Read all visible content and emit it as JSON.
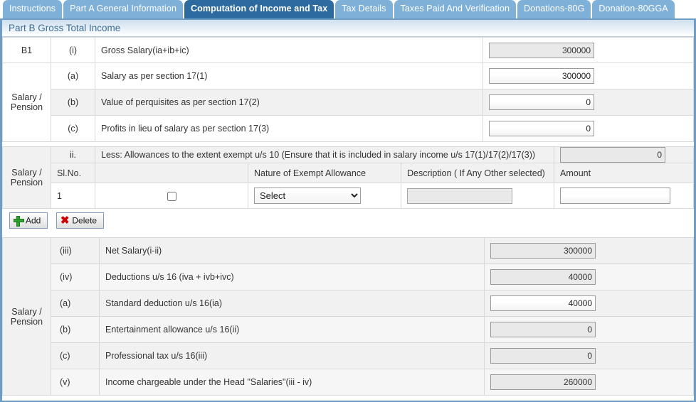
{
  "tabs": [
    {
      "label": "Instructions",
      "active": false
    },
    {
      "label": "Part A General Information",
      "active": false
    },
    {
      "label": "Computation of Income and Tax",
      "active": true
    },
    {
      "label": "Tax Details",
      "active": false
    },
    {
      "label": "Taxes Paid And Verification",
      "active": false
    },
    {
      "label": "Donations-80G",
      "active": false
    },
    {
      "label": "Donation-80GGA",
      "active": false
    }
  ],
  "section": {
    "title": "Part B Gross Total Income"
  },
  "rows": {
    "b1": {
      "code": "B1",
      "roman": "(i)",
      "label": "Gross Salary(ia+ib+ic)",
      "value": "300000",
      "readonly": true
    },
    "group1_label": "Salary /\nPension",
    "a": {
      "roman": "(a)",
      "label": "Salary as per section 17(1)",
      "value": "300000",
      "readonly": false
    },
    "b": {
      "roman": "(b)",
      "label": "Value of perquisites as per section 17(2)",
      "value": "0",
      "readonly": false
    },
    "c": {
      "roman": "(c)",
      "label": "Profits in lieu of salary as per section 17(3)",
      "value": "0",
      "readonly": false
    },
    "ii": {
      "roman": "ii.",
      "label": "Less: Allowances to the extent exempt u/s 10 (Ensure that it is included in salary income u/s 17(1)/17(2)/17(3))",
      "value": "0",
      "readonly": true
    },
    "group2_label": "Salary /\nPension",
    "iii": {
      "roman": "(iii)",
      "label": "Net Salary(i-ii)",
      "value": "300000",
      "readonly": true
    },
    "iv": {
      "roman": "(iv)",
      "label": "Deductions u/s 16 (iva + ivb+ivc)",
      "value": "40000",
      "readonly": true
    },
    "d_a": {
      "roman": "(a)",
      "label": "Standard deduction u/s 16(ia)",
      "value": "40000",
      "readonly": false
    },
    "d_b": {
      "roman": "(b)",
      "label": "Entertainment allowance u/s 16(ii)",
      "value": "0",
      "readonly": true
    },
    "d_c": {
      "roman": "(c)",
      "label": "Professional tax u/s 16(iii)",
      "value": "0",
      "readonly": true
    },
    "v": {
      "roman": "(v)",
      "label": "Income chargeable under the Head \"Salaries\"(iii - iv)",
      "value": "260000",
      "readonly": true
    },
    "group3_label": "Salary /\nPension"
  },
  "allowance_table": {
    "headers": {
      "sl": "Sl.No.",
      "check": "",
      "nature": "Nature of Exempt Allowance",
      "description": "Description ( If Any Other selected)",
      "amount": "Amount"
    },
    "rows": [
      {
        "sl": "1",
        "checked": false,
        "nature_selected": "Select",
        "nature_options": [
          "Select"
        ],
        "description": "",
        "amount": ""
      }
    ],
    "buttons": {
      "add": "Add",
      "delete": "Delete"
    }
  },
  "colors": {
    "tab_active": "#2d6a9f",
    "tab_inactive": "#7fb0d8",
    "frame_border": "#6e9cc4",
    "section_text": "#3f6f95"
  }
}
